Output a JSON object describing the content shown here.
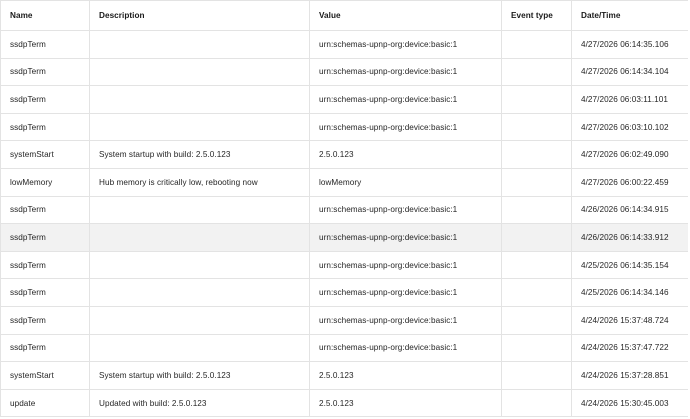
{
  "columns": [
    "Name",
    "Description",
    "Value",
    "Event type",
    "Date/Time"
  ],
  "rows": [
    {
      "name": "ssdpTerm",
      "description": "",
      "value": "urn:schemas-upnp-org:device:basic:1",
      "event_type": "",
      "datetime": "4/27/2026 06:14:35.106"
    },
    {
      "name": "ssdpTerm",
      "description": "",
      "value": "urn:schemas-upnp-org:device:basic:1",
      "event_type": "",
      "datetime": "4/27/2026 06:14:34.104"
    },
    {
      "name": "ssdpTerm",
      "description": "",
      "value": "urn:schemas-upnp-org:device:basic:1",
      "event_type": "",
      "datetime": "4/27/2026 06:03:11.101"
    },
    {
      "name": "ssdpTerm",
      "description": "",
      "value": "urn:schemas-upnp-org:device:basic:1",
      "event_type": "",
      "datetime": "4/27/2026 06:03:10.102"
    },
    {
      "name": "systemStart",
      "description": "System startup with build: 2.5.0.123",
      "value": "2.5.0.123",
      "event_type": "",
      "datetime": "4/27/2026 06:02:49.090"
    },
    {
      "name": "lowMemory",
      "description": "Hub memory is critically low, rebooting now",
      "value": "lowMemory",
      "event_type": "",
      "datetime": "4/27/2026 06:00:22.459"
    },
    {
      "name": "ssdpTerm",
      "description": "",
      "value": "urn:schemas-upnp-org:device:basic:1",
      "event_type": "",
      "datetime": "4/26/2026 06:14:34.915"
    },
    {
      "name": "ssdpTerm",
      "description": "",
      "value": "urn:schemas-upnp-org:device:basic:1",
      "event_type": "",
      "datetime": "4/26/2026 06:14:33.912"
    },
    {
      "name": "ssdpTerm",
      "description": "",
      "value": "urn:schemas-upnp-org:device:basic:1",
      "event_type": "",
      "datetime": "4/25/2026 06:14:35.154"
    },
    {
      "name": "ssdpTerm",
      "description": "",
      "value": "urn:schemas-upnp-org:device:basic:1",
      "event_type": "",
      "datetime": "4/25/2026 06:14:34.146"
    },
    {
      "name": "ssdpTerm",
      "description": "",
      "value": "urn:schemas-upnp-org:device:basic:1",
      "event_type": "",
      "datetime": "4/24/2026 15:37:48.724"
    },
    {
      "name": "ssdpTerm",
      "description": "",
      "value": "urn:schemas-upnp-org:device:basic:1",
      "event_type": "",
      "datetime": "4/24/2026 15:37:47.722"
    },
    {
      "name": "systemStart",
      "description": "System startup with build: 2.5.0.123",
      "value": "2.5.0.123",
      "event_type": "",
      "datetime": "4/24/2026 15:37:28.851"
    },
    {
      "name": "update",
      "description": "Updated with build: 2.5.0.123",
      "value": "2.5.0.123",
      "event_type": "",
      "datetime": "4/24/2026 15:30:45.003"
    }
  ],
  "highlighted_row": 7,
  "colors": {
    "border": "#e3e3e3",
    "row_highlight": "#f2f2f2",
    "text": "#262626"
  }
}
